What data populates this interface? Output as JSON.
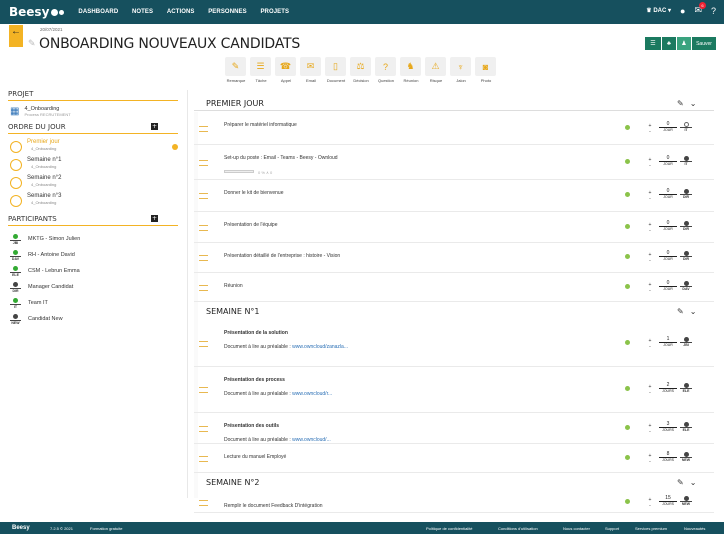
{
  "topbar": {
    "logo": "Beesy",
    "nav": [
      "DASHBOARD",
      "NOTES",
      "ACTIONS",
      "PERSONNES",
      "PROJETS"
    ],
    "user": "DAC",
    "notif_count": "6"
  },
  "header": {
    "date": "20/07/2021",
    "title": "ONBOARDING NOUVEAUX CANDIDATS",
    "save_label": "Sauver"
  },
  "tools": [
    "Remarque",
    "Tâche",
    "Appel",
    "Email",
    "Document",
    "Décision",
    "Question",
    "Réunion",
    "Risque",
    "Jalon",
    "Photo"
  ],
  "sidebar": {
    "project_head": "PROJET",
    "project_name": "4_Onboarding",
    "project_sub": "Process RECRUTEMENT",
    "agenda_head": "ORDRE DU JOUR",
    "agenda": [
      {
        "title": "Premier jour",
        "sub": "4_Onboarding"
      },
      {
        "title": "Semaine n°1",
        "sub": "4_Onboarding"
      },
      {
        "title": "Semaine n°2",
        "sub": "4_Onboarding"
      },
      {
        "title": "Semaine n°3",
        "sub": "4_Onboarding"
      }
    ],
    "participants_head": "PARTICIPANTS",
    "participants": [
      {
        "tag": "JBI",
        "name": "MKTG - Simon Julien",
        "green": true
      },
      {
        "tag": "DAV",
        "name": "RH - Antoine David",
        "green": true
      },
      {
        "tag": "ELE",
        "name": "CSM - Lebrun Emma",
        "green": true
      },
      {
        "tag": "DIR",
        "name": "Manager Candidat",
        "green": false
      },
      {
        "tag": "IT",
        "name": "Team IT",
        "green": true
      },
      {
        "tag": "NEW",
        "name": "Candidat New",
        "green": false
      }
    ]
  },
  "sections": [
    {
      "title": "PREMIER JOUR"
    },
    {
      "title": "SEMAINE N°1"
    },
    {
      "title": "SEMAINE N°2"
    }
  ],
  "items": [
    {
      "title": "Préparer le matériel informatique",
      "sub": "",
      "link": "",
      "dur": "0",
      "unit": "JOUR",
      "owner": "IT"
    },
    {
      "title": "Set-up du poste : Email - Teams - Beesy - Ownloud",
      "sub": "",
      "link": "",
      "dur": "0",
      "unit": "JOUR",
      "owner": "IT",
      "progress": "0 %  ∧ 0"
    },
    {
      "title": "Donner le kit de bienvenue",
      "sub": "",
      "link": "",
      "dur": "0",
      "unit": "JOUR",
      "owner": "DIR"
    },
    {
      "title": "Présentation de l'équipe",
      "sub": "",
      "link": "",
      "dur": "0",
      "unit": "JOUR",
      "owner": "DIR"
    },
    {
      "title": "Présentation détaillé de l'entreprise : histoire - Vision",
      "sub": "",
      "link": "",
      "dur": "0",
      "unit": "JOUR",
      "owner": "DIR"
    },
    {
      "title": "Réunion",
      "sub": "",
      "link": "",
      "dur": "0",
      "unit": "JOUR",
      "owner": "DAV"
    },
    {
      "title": "Présentation de la solution",
      "sub": "Document à lire au préalable :",
      "link": "www.owncloud/zanazla...",
      "dur": "1",
      "unit": "JOUR",
      "owner": "JBI"
    },
    {
      "title": "Présentation des process",
      "sub": "Document à lire au préalable :",
      "link": "www.owncloud/r...",
      "dur": "2",
      "unit": "JOURS",
      "owner": "ELE"
    },
    {
      "title": "Présentation des outils",
      "sub": "Document à lire au préalable :",
      "link": "www.owncloud/...",
      "dur": "3",
      "unit": "JOURS",
      "owner": "ELE"
    },
    {
      "title": "Lecture du manuel Employé",
      "sub": "",
      "link": "",
      "dur": "8",
      "unit": "JOURS",
      "owner": "NEW"
    },
    {
      "title": "Remplir le document Feedback D'intégration",
      "sub": "",
      "link": "",
      "dur": "15",
      "unit": "JOURS",
      "owner": "NEW"
    }
  ],
  "footer": {
    "brand": "Beesy",
    "version": "7.2.5 © 2021",
    "training": "Formation gratuite",
    "privacy": "Politique de confidentialité",
    "terms": "Conditions d'utilisation",
    "contact": "Nous contacter",
    "support": "Support",
    "premium": "Services premium",
    "news": "Nouveautés"
  },
  "colors": {
    "primary": "#16505e",
    "accent": "#f3b324",
    "green": "#1b7a60",
    "link": "#2a6fb5"
  }
}
